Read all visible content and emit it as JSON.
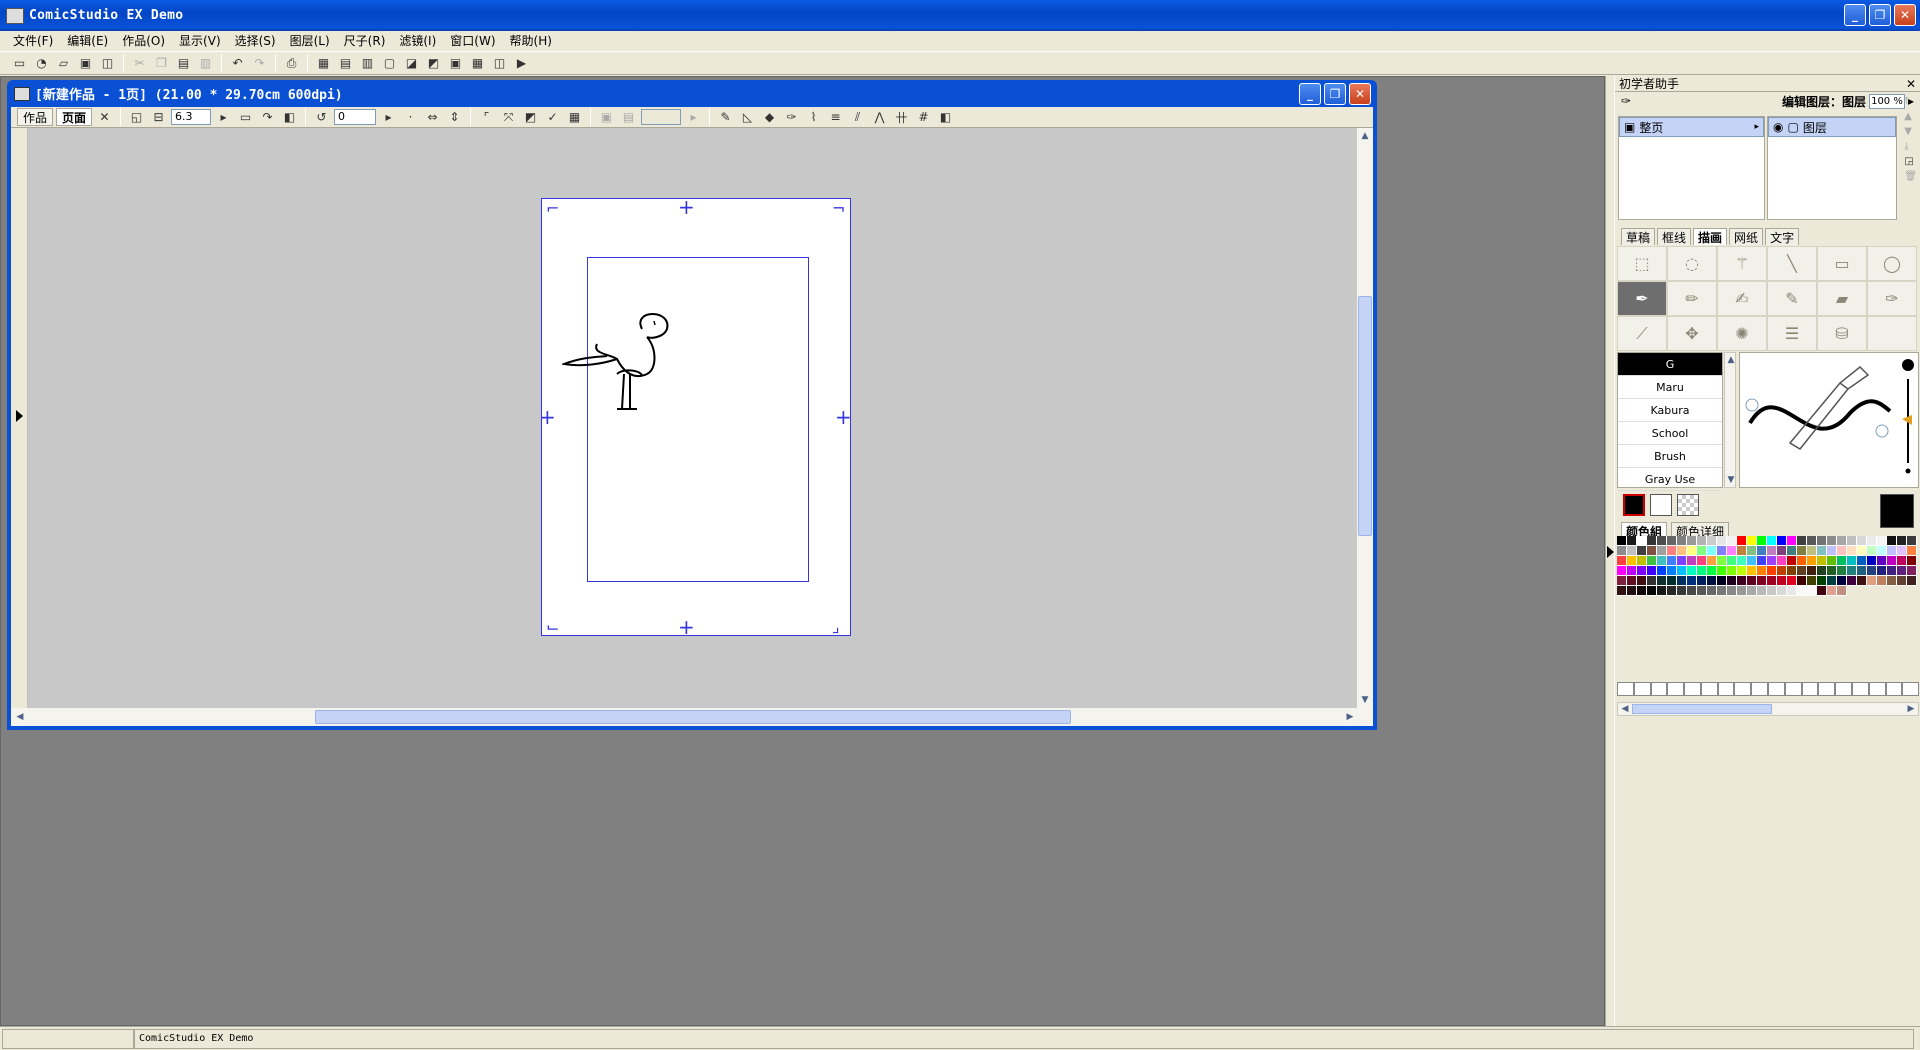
{
  "app": {
    "title": "ComicStudio EX Demo"
  },
  "menu": [
    "文件(F)",
    "编辑(E)",
    "作品(O)",
    "显示(V)",
    "选择(S)",
    "图层(L)",
    "尺子(R)",
    "滤镜(I)",
    "窗口(W)",
    "帮助(H)"
  ],
  "document": {
    "title": "[新建作品 - 1页] (21.00 * 29.70cm 600dpi)",
    "tabs": [
      "作品",
      "页面"
    ],
    "zoom_value": "6.3",
    "rotate_value": "0"
  },
  "right_panel": {
    "title": "初学者助手",
    "edit_layer_label": "编辑图层：图层",
    "zoom": "100 %",
    "page_item": "整页",
    "layer_item": "图层",
    "tool_tabs": [
      "草稿",
      "框线",
      "描画",
      "网纸",
      "文字"
    ],
    "active_tool_tab": "描画",
    "pens": [
      "G",
      "Maru",
      "Kabura",
      "School",
      "Brush",
      "Gray Use"
    ],
    "active_pen": "G",
    "color_tabs": [
      "颜色組",
      "颜色详细"
    ],
    "palette": [
      "#000000",
      "#1a1a1a",
      "#ffffff",
      "#333333",
      "#4d4d4d",
      "#666666",
      "#808080",
      "#999999",
      "#b3b3b3",
      "#cccccc",
      "#e6e6e6",
      "#f2f2f2",
      "#ff0000",
      "#ffff00",
      "#00ff00",
      "#00ffff",
      "#0000ff",
      "#ff00ff",
      "#404040",
      "#595959",
      "#737373",
      "#8c8c8c",
      "#a6a6a6",
      "#bfbfbf",
      "#d9d9d9",
      "#ebebeb",
      "#f5f5f5",
      "#111111",
      "#222222",
      "#3b3b3b",
      "#8c8c8c",
      "#c0c0c0",
      "#404040",
      "#805040",
      "#a0a0a0",
      "#ff8080",
      "#ffc080",
      "#ffff80",
      "#80ff80",
      "#80ffff",
      "#8080ff",
      "#ff80ff",
      "#c08040",
      "#80c080",
      "#4080c0",
      "#c080c0",
      "#804080",
      "#408080",
      "#808040",
      "#c0c080",
      "#80c0c0",
      "#c0c0ff",
      "#ffc0c0",
      "#ffe0c0",
      "#ffffc0",
      "#c0ffc0",
      "#c0ffff",
      "#c0c0ff",
      "#e0c0ff",
      "#ff8040",
      "#ff4040",
      "#ffc000",
      "#c0c000",
      "#40c040",
      "#40c0c0",
      "#4080ff",
      "#8040ff",
      "#c040c0",
      "#ff4080",
      "#ffa040",
      "#80ff40",
      "#40ff80",
      "#40ffc0",
      "#40c0ff",
      "#4040ff",
      "#a040ff",
      "#ff40c0",
      "#c00000",
      "#ff6000",
      "#ffa000",
      "#c0c000",
      "#60c000",
      "#00c060",
      "#00c0c0",
      "#0060c0",
      "#0000c0",
      "#6000c0",
      "#c000c0",
      "#c00060",
      "#800000",
      "#ff00ff",
      "#c000ff",
      "#8000ff",
      "#4000ff",
      "#0040ff",
      "#0080ff",
      "#00c0ff",
      "#00ffc0",
      "#00ff80",
      "#00ff40",
      "#40ff00",
      "#80ff00",
      "#c0ff00",
      "#ffc000",
      "#ff8000",
      "#ff4000",
      "#c04000",
      "#804000",
      "#604020",
      "#402010",
      "#204020",
      "#206020",
      "#208040",
      "#208080",
      "#206080",
      "#204080",
      "#202080",
      "#402080",
      "#602080",
      "#802060",
      "#802040",
      "#601020",
      "#401010",
      "#303030",
      "#103030",
      "#003030",
      "#003060",
      "#003080",
      "#002060",
      "#001040",
      "#000020",
      "#200020",
      "#400020",
      "#600020",
      "#800020",
      "#a00020",
      "#c00020",
      "#e00020",
      "#400000",
      "#404000",
      "#004000",
      "#004040",
      "#000040",
      "#400040",
      "#401010",
      "#e0a080",
      "#c08060",
      "#806040",
      "#604030",
      "#402020",
      "#301010",
      "#201010",
      "#100808",
      "#080808",
      "#181818",
      "#282828",
      "#383838",
      "#484848",
      "#585858",
      "#686868",
      "#787878",
      "#888888",
      "#989898",
      "#a8a8a8",
      "#b8b8b8",
      "#c8c8c8",
      "#d8d8d8",
      "#e8e8e8",
      "#f8f8f8",
      "#fafafa",
      "#400010",
      "#e0a090",
      "#c09080"
    ]
  },
  "status": {
    "text": "ComicStudio EX Demo"
  }
}
